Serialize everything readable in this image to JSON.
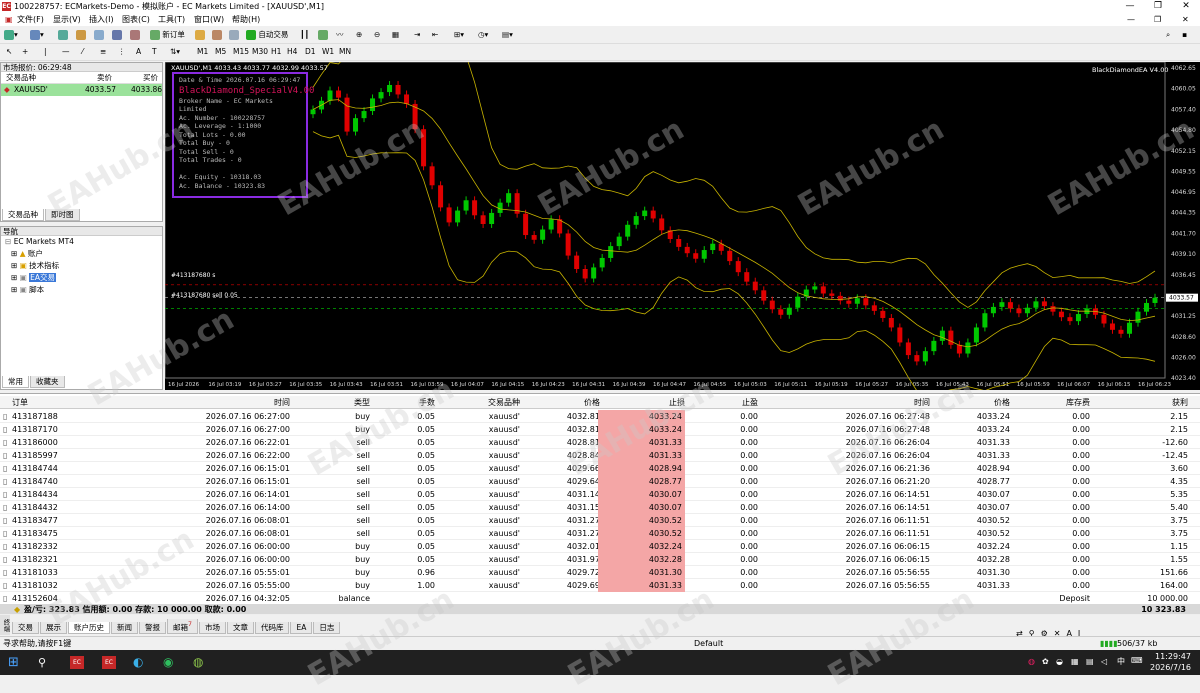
{
  "title": "100228757: ECMarkets-Demo - 模拟账户 - EC Markets Limited - [XAUUSD',M1]",
  "app_icon": "EC",
  "menu": [
    "文件(F)",
    "显示(V)",
    "插入(I)",
    "图表(C)",
    "工具(T)",
    "窗口(W)",
    "帮助(H)"
  ],
  "toolbar": {
    "new_order": "新订单",
    "auto_trade": "自动交易"
  },
  "timeframes": [
    "M1",
    "M5",
    "M15",
    "M30",
    "H1",
    "H4",
    "D1",
    "W1",
    "MN"
  ],
  "market_watch": {
    "header": "市场报价: 06:29:48",
    "col_symbol": "交易品种",
    "col_bid": "卖价",
    "col_ask": "买价",
    "rows": [
      {
        "symbol": "XAUUSD'",
        "bid": "4033.57",
        "ask": "4033.86"
      }
    ],
    "tabs": [
      "交易品种",
      "即时图"
    ]
  },
  "navigator": {
    "header": "导航",
    "root": "EC Markets MT4",
    "items": [
      "账户",
      "技术指标",
      "EA交易",
      "脚本"
    ],
    "tabs": [
      "常用",
      "收藏夹"
    ]
  },
  "chart": {
    "header": "XAUUSD',M1  4033.43 4033.77 4032.99 4033.57",
    "ea_label": "BlackDiamondEA V4.00",
    "order_line1": "#413187680 s",
    "order_line2": "#413187680 sell 0.05",
    "price_labels": [
      "4062.65",
      "4060.05",
      "4057.40",
      "4054.80",
      "4052.15",
      "4049.55",
      "4046.95",
      "4044.35",
      "4041.70",
      "4039.10",
      "4036.45",
      "4033.57",
      "4031.25",
      "4028.60",
      "4026.00",
      "4023.40"
    ],
    "current_price": "4033.57",
    "time_labels": [
      "16 Jul 2026",
      "16 Jul 03:19",
      "16 Jul 03:27",
      "16 Jul 03:35",
      "16 Jul 03:43",
      "16 Jul 03:51",
      "16 Jul 03:59",
      "16 Jul 04:07",
      "16 Jul 04:15",
      "16 Jul 04:23",
      "16 Jul 04:31",
      "16 Jul 04:39",
      "16 Jul 04:47",
      "16 Jul 04:55",
      "16 Jul 05:03",
      "16 Jul 05:11",
      "16 Jul 05:19",
      "16 Jul 05:27",
      "16 Jul 05:35",
      "16 Jul 05:43",
      "16 Jul 05:51",
      "16 Jul 05:59",
      "16 Jul 06:07",
      "16 Jul 06:15",
      "16 Jul 06:23"
    ],
    "candle_closes": [
      4057.4,
      4058.5,
      4059.8,
      4058.9,
      4054.6,
      4056.3,
      4057.2,
      4058.8,
      4059.6,
      4060.5,
      4059.3,
      4058.1,
      4054.9,
      4050.2,
      4047.8,
      4045.0,
      4043.1,
      4044.6,
      4045.9,
      4044.0,
      4042.9,
      4044.3,
      4045.6,
      4046.8,
      4044.2,
      4041.5,
      4040.9,
      4042.2,
      4043.5,
      4041.7,
      4038.9,
      4037.2,
      4036.0,
      4037.4,
      4038.6,
      4040.1,
      4041.3,
      4042.8,
      4043.9,
      4044.6,
      4043.6,
      4042.1,
      4041.0,
      4040.0,
      4039.2,
      4038.5,
      4039.6,
      4040.4,
      4039.5,
      4038.2,
      4036.8,
      4035.6,
      4034.5,
      4033.2,
      4032.1,
      4031.4,
      4032.3,
      4033.7,
      4034.6,
      4035.0,
      4034.1,
      4033.8,
      4033.2,
      4032.8,
      4033.5,
      4032.6,
      4031.9,
      4031.0,
      4029.8,
      4027.9,
      4026.3,
      4025.5,
      4026.8,
      4028.1,
      4029.4,
      4027.6,
      4026.5,
      4027.9,
      4029.8,
      4031.6,
      4032.4,
      4033.0,
      4032.2,
      4031.6,
      4032.3,
      4033.1,
      4032.5,
      4031.8,
      4031.1,
      4030.6,
      4031.5,
      4032.2,
      4031.4,
      4030.3,
      4029.5,
      4029.0,
      4030.4,
      4031.8,
      4032.9,
      4033.57
    ],
    "info_panel": {
      "datetime": "Date & Time 2026.07.16 06:29:47",
      "name": "BlackDiamond_SpecialV4.00",
      "lines": [
        "Broker Name - EC Markets Limited",
        "Ac. Number - 100228757",
        "Ac. Leverage - 1:1000",
        "Total Lots - 0.00",
        "Total Buy - 0",
        "Total Sell - 0",
        "Total Trades - 0",
        "",
        "Ac. Equity - 10318.03",
        "Ac. Balance - 10323.83"
      ]
    }
  },
  "orders": {
    "headers": [
      "订单",
      "时间",
      "类型",
      "手数",
      "交易品种",
      "价格",
      "止损",
      "止盈",
      "时间",
      "价格",
      "库存费",
      "获利"
    ],
    "rows": [
      [
        "413187188",
        "2026.07.16 06:27:00",
        "buy",
        "0.05",
        "xauusd'",
        "4032.81",
        "4033.24",
        "0.00",
        "2026.07.16 06:27:48",
        "4033.24",
        "0.00",
        "2.15"
      ],
      [
        "413187170",
        "2026.07.16 06:27:00",
        "buy",
        "0.05",
        "xauusd'",
        "4032.81",
        "4033.24",
        "0.00",
        "2026.07.16 06:27:48",
        "4033.24",
        "0.00",
        "2.15"
      ],
      [
        "413186000",
        "2026.07.16 06:22:01",
        "sell",
        "0.05",
        "xauusd'",
        "4028.81",
        "4031.33",
        "0.00",
        "2026.07.16 06:26:04",
        "4031.33",
        "0.00",
        "-12.60"
      ],
      [
        "413185997",
        "2026.07.16 06:22:00",
        "sell",
        "0.05",
        "xauusd'",
        "4028.84",
        "4031.33",
        "0.00",
        "2026.07.16 06:26:04",
        "4031.33",
        "0.00",
        "-12.45"
      ],
      [
        "413184744",
        "2026.07.16 06:15:01",
        "sell",
        "0.05",
        "xauusd'",
        "4029.66",
        "4028.94",
        "0.00",
        "2026.07.16 06:21:36",
        "4028.94",
        "0.00",
        "3.60"
      ],
      [
        "413184740",
        "2026.07.16 06:15:01",
        "sell",
        "0.05",
        "xauusd'",
        "4029.64",
        "4028.77",
        "0.00",
        "2026.07.16 06:21:20",
        "4028.77",
        "0.00",
        "4.35"
      ],
      [
        "413184434",
        "2026.07.16 06:14:01",
        "sell",
        "0.05",
        "xauusd'",
        "4031.14",
        "4030.07",
        "0.00",
        "2026.07.16 06:14:51",
        "4030.07",
        "0.00",
        "5.35"
      ],
      [
        "413184432",
        "2026.07.16 06:14:00",
        "sell",
        "0.05",
        "xauusd'",
        "4031.15",
        "4030.07",
        "0.00",
        "2026.07.16 06:14:51",
        "4030.07",
        "0.00",
        "5.40"
      ],
      [
        "413183477",
        "2026.07.16 06:08:01",
        "sell",
        "0.05",
        "xauusd'",
        "4031.27",
        "4030.52",
        "0.00",
        "2026.07.16 06:11:51",
        "4030.52",
        "0.00",
        "3.75"
      ],
      [
        "413183475",
        "2026.07.16 06:08:01",
        "sell",
        "0.05",
        "xauusd'",
        "4031.27",
        "4030.52",
        "0.00",
        "2026.07.16 06:11:51",
        "4030.52",
        "0.00",
        "3.75"
      ],
      [
        "413182332",
        "2026.07.16 06:00:00",
        "buy",
        "0.05",
        "xauusd'",
        "4032.01",
        "4032.24",
        "0.00",
        "2026.07.16 06:06:15",
        "4032.24",
        "0.00",
        "1.15"
      ],
      [
        "413182321",
        "2026.07.16 06:00:00",
        "buy",
        "0.05",
        "xauusd'",
        "4031.97",
        "4032.28",
        "0.00",
        "2026.07.16 06:06:15",
        "4032.28",
        "0.00",
        "1.55"
      ],
      [
        "413181033",
        "2026.07.16 05:55:01",
        "buy",
        "0.96",
        "xauusd'",
        "4029.72",
        "4031.30",
        "0.00",
        "2026.07.16 05:56:55",
        "4031.30",
        "0.00",
        "151.66"
      ],
      [
        "413181032",
        "2026.07.16 05:55:00",
        "buy",
        "1.00",
        "xauusd'",
        "4029.69",
        "4031.33",
        "0.00",
        "2026.07.16 05:56:55",
        "4031.33",
        "0.00",
        "164.00"
      ]
    ],
    "balance_row": {
      "ticket": "413152604",
      "time": "2026.07.16 04:32:05",
      "type": "balance",
      "label": "Deposit",
      "amount": "10 000.00"
    },
    "summary": "盈/亏: 323.83  信用额: 0.00  存款: 10 000.00  取款: 0.00",
    "summary_total": "10 323.83"
  },
  "terminal_tabs": [
    "交易",
    "展示",
    "账户历史",
    "新闻",
    "警报",
    "邮箱",
    "市场",
    "文章",
    "代码库",
    "EA",
    "日志"
  ],
  "terminal_side_label": "终端",
  "mail_badge": "7",
  "status": {
    "help": "寻求帮助,请按F1键",
    "profile": "Default",
    "traffic": "506/37 kb"
  },
  "taskbar": {
    "time": "11:29:47",
    "date": "2026/7/16",
    "lang": "中"
  },
  "watermark": "EAHub.cn",
  "colors": {
    "bull": "#00c800",
    "bear": "#e00000",
    "band": "#c8b400",
    "profit_cell": "#f4a6a6"
  }
}
